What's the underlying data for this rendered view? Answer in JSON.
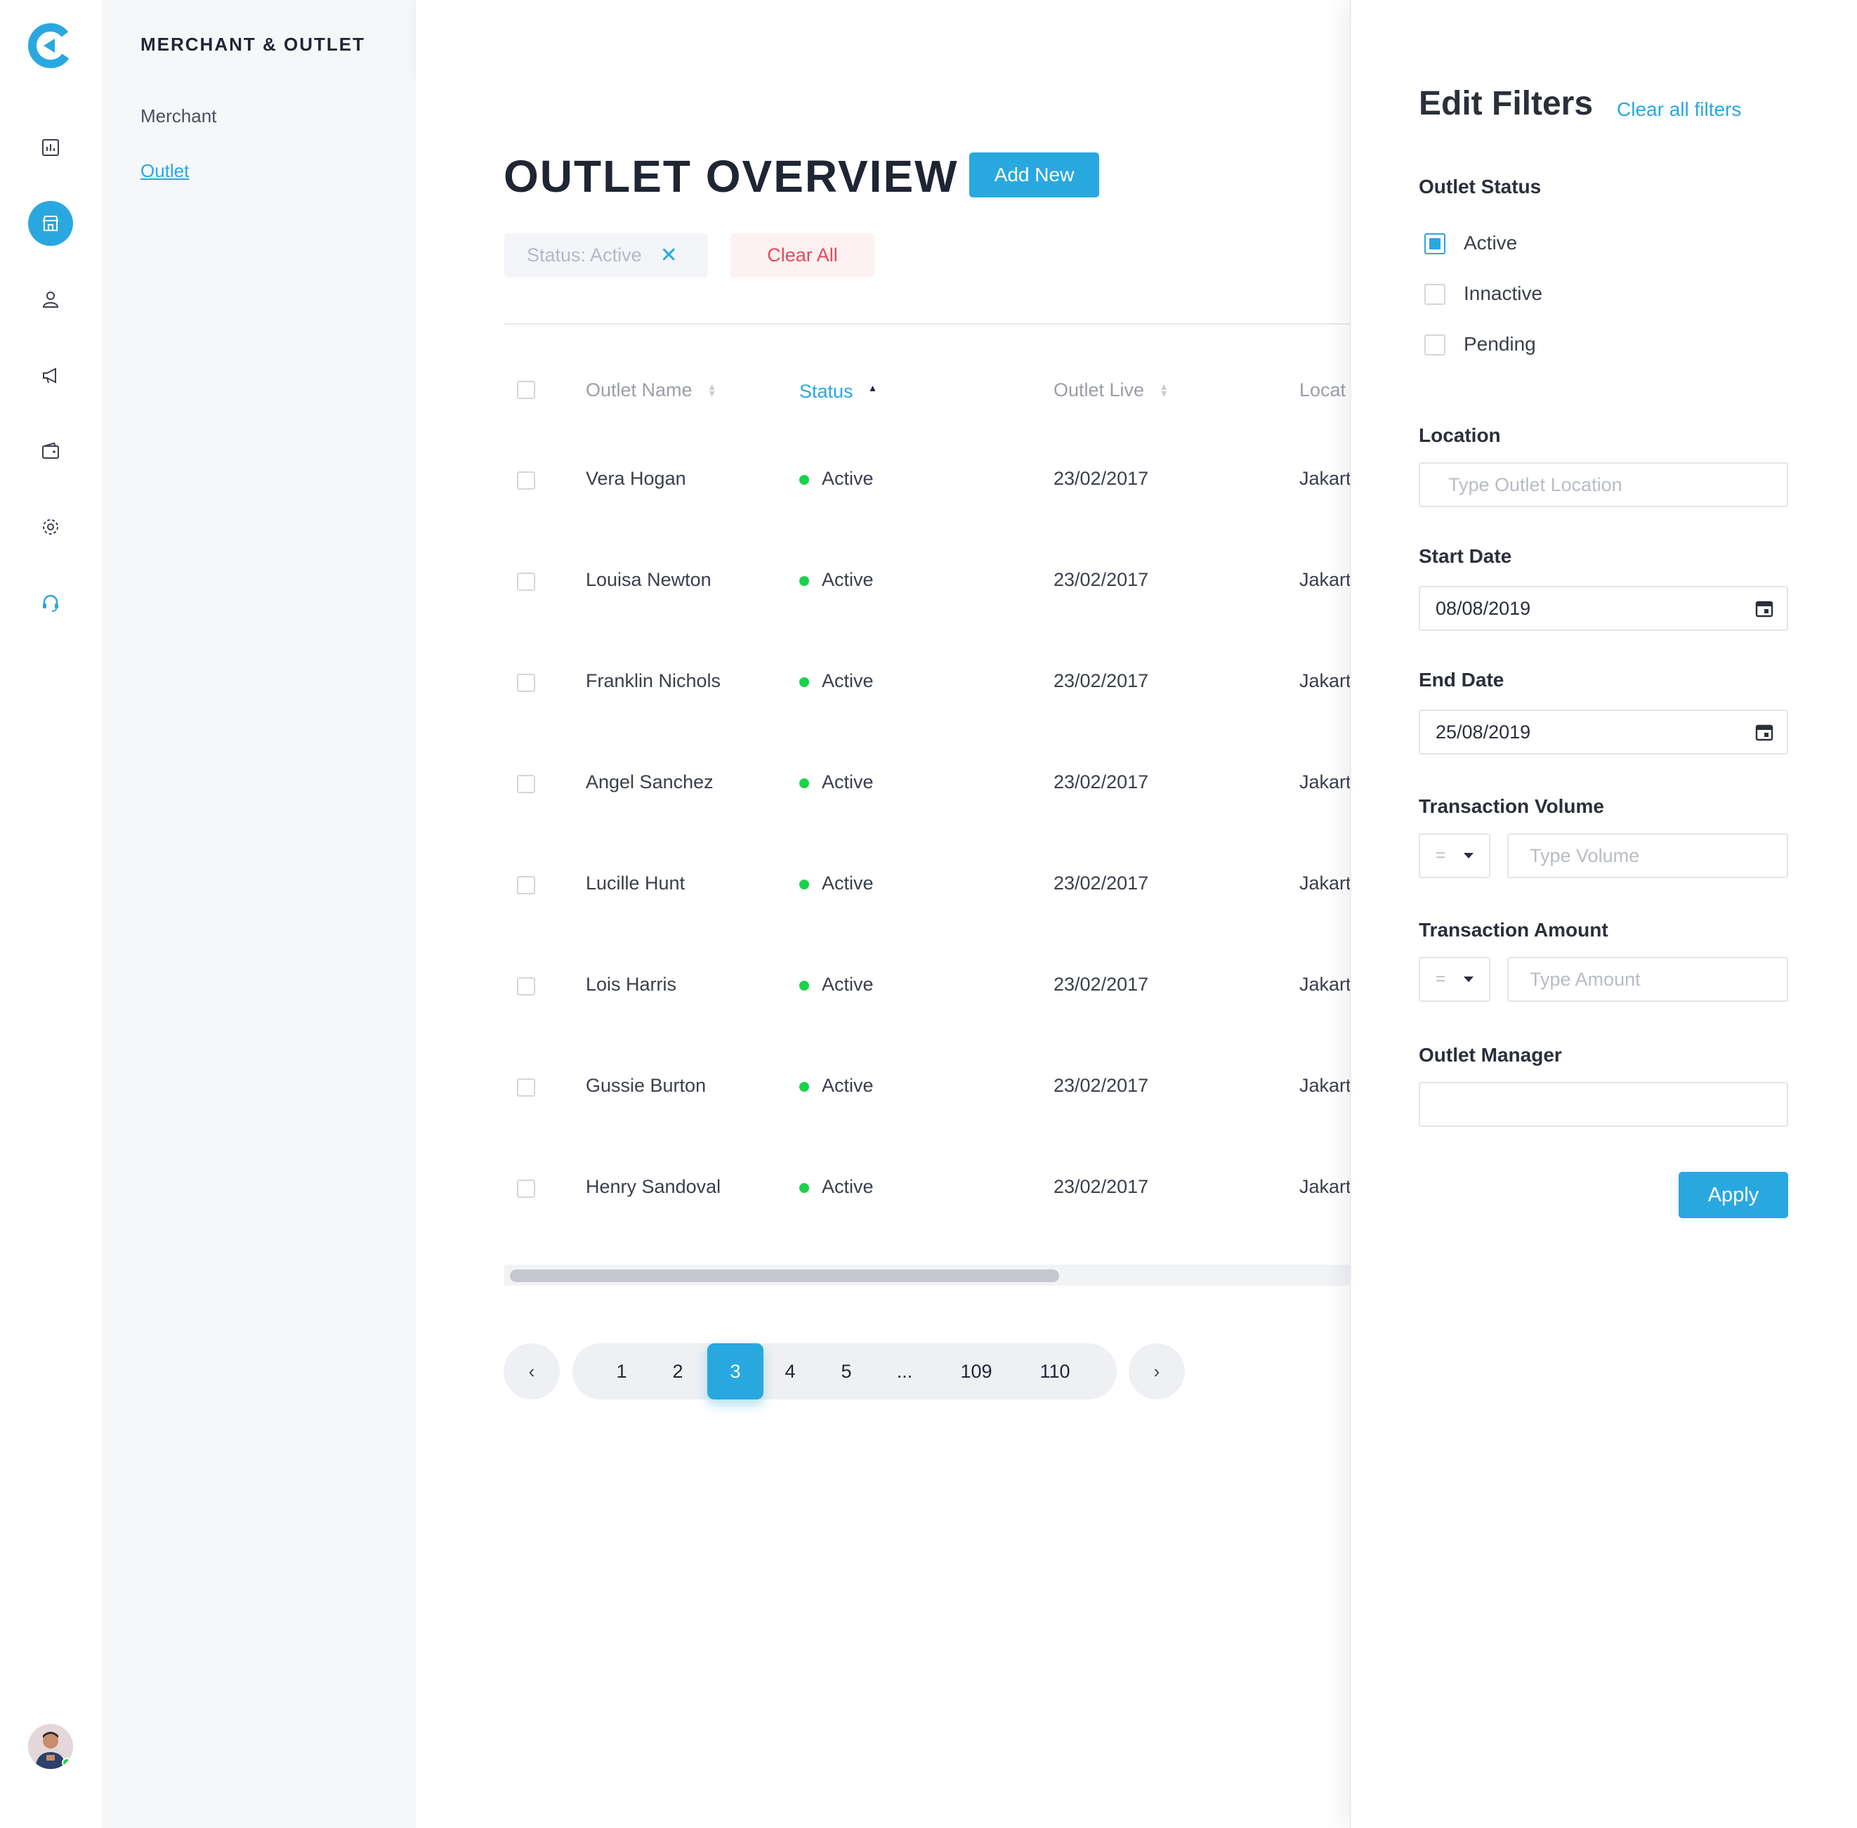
{
  "app": {
    "logo_icon": "brand-c-logo",
    "accent_color": "#29a8e0",
    "danger_color": "#e24a5d",
    "status_active_color": "#19d34a"
  },
  "rail": {
    "icons": [
      "dashboard-icon",
      "store-icon",
      "user-icon",
      "megaphone-icon",
      "wallet-icon",
      "settings-icon",
      "headset-icon"
    ],
    "active": "store-icon"
  },
  "subnav": {
    "title": "MERCHANT & OUTLET",
    "items": [
      {
        "label": "Merchant"
      },
      {
        "label": "Outlet",
        "active": true
      }
    ]
  },
  "main": {
    "title": "OUTLET OVERVIEW",
    "add_new_label": "Add New",
    "active_filter_chip": "Status: Active",
    "clear_all_label": "Clear All",
    "columns": [
      "Outlet Name",
      "Status",
      "Outlet Live",
      "Locat"
    ],
    "rows": [
      {
        "name": "Vera Hogan",
        "status": "Active",
        "live": "23/02/2017",
        "location": "Jakart"
      },
      {
        "name": "Louisa Newton",
        "status": "Active",
        "live": "23/02/2017",
        "location": "Jakart"
      },
      {
        "name": "Franklin Nichols",
        "status": "Active",
        "live": "23/02/2017",
        "location": "Jakart"
      },
      {
        "name": "Angel Sanchez",
        "status": "Active",
        "live": "23/02/2017",
        "location": "Jakart"
      },
      {
        "name": "Lucille Hunt",
        "status": "Active",
        "live": "23/02/2017",
        "location": "Jakart"
      },
      {
        "name": "Lois Harris",
        "status": "Active",
        "live": "23/02/2017",
        "location": "Jakart"
      },
      {
        "name": "Gussie Burton",
        "status": "Active",
        "live": "23/02/2017",
        "location": "Jakart"
      },
      {
        "name": "Henry Sandoval",
        "status": "Active",
        "live": "23/02/2017",
        "location": "Jakart"
      }
    ],
    "pagination": {
      "prev": "‹",
      "next": "›",
      "pages": [
        "1",
        "2",
        "3",
        "4",
        "5",
        "...",
        "109",
        "110"
      ],
      "current": "3"
    }
  },
  "filters": {
    "title": "Edit Filters",
    "clear_all_label": "Clear all filters",
    "outlet_status_label": "Outlet Status",
    "status_options": [
      {
        "label": "Active",
        "checked": true
      },
      {
        "label": "Innactive",
        "checked": false
      },
      {
        "label": "Pending",
        "checked": false
      }
    ],
    "location_label": "Location",
    "location_placeholder": "Type Outlet Location",
    "start_date_label": "Start Date",
    "start_date_value": "08/08/2019",
    "end_date_label": "End Date",
    "end_date_value": "25/08/2019",
    "volume_label": "Transaction Volume",
    "volume_operator": "=",
    "volume_placeholder": "Type Volume",
    "amount_label": "Transaction Amount",
    "amount_operator": "=",
    "amount_placeholder": "Type Amount",
    "manager_label": "Outlet Manager",
    "manager_value": "",
    "apply_label": "Apply"
  }
}
